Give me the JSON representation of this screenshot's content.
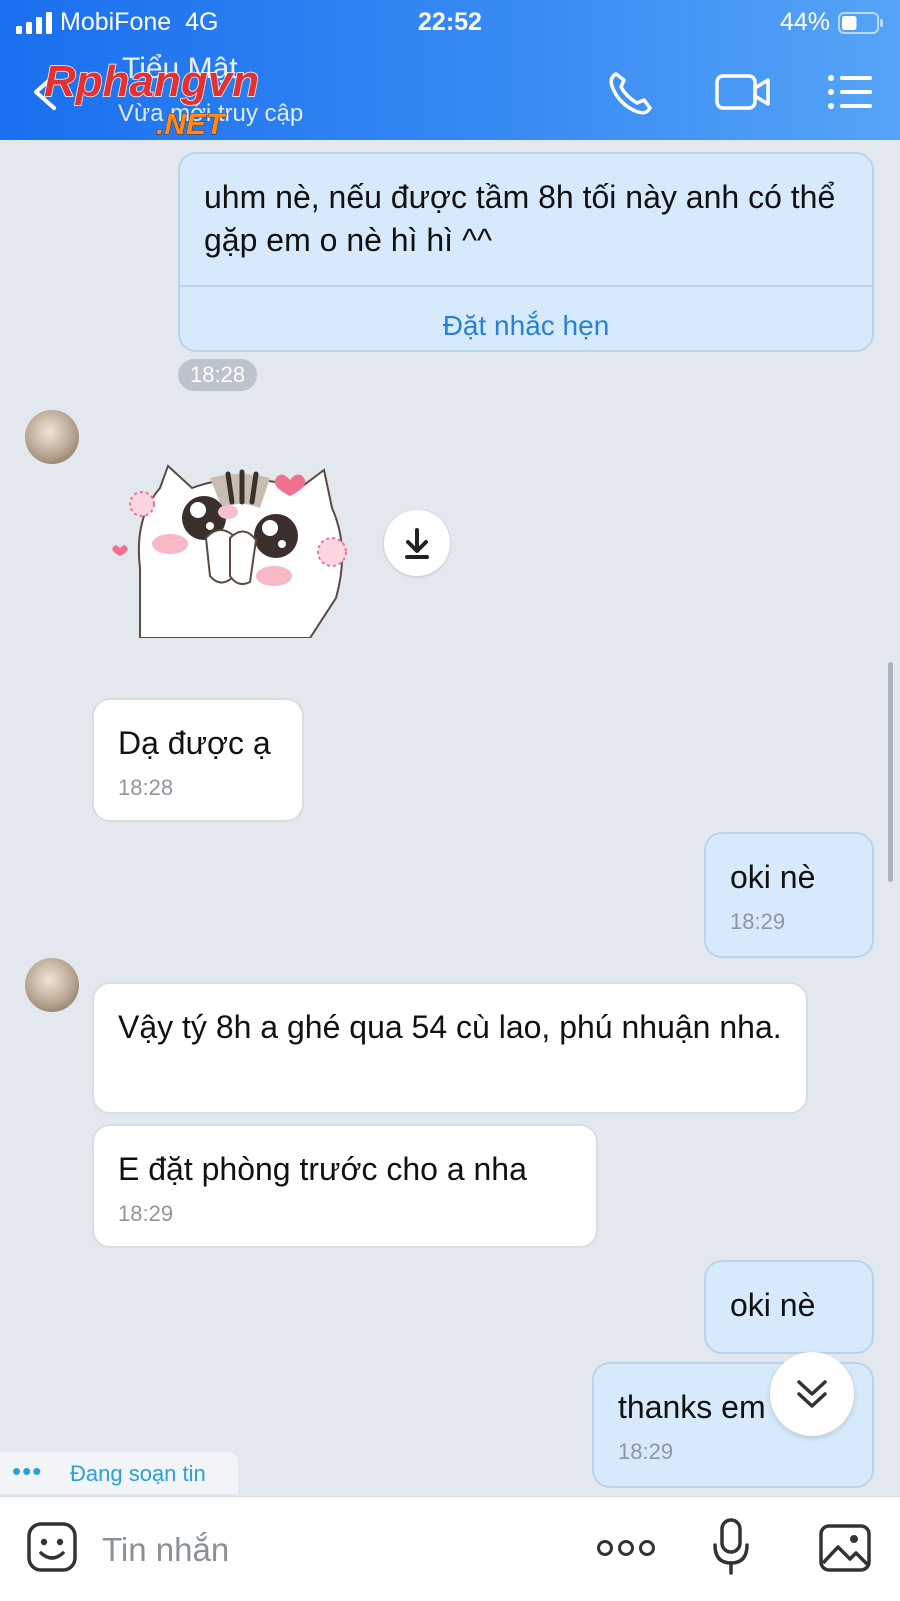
{
  "status_bar": {
    "carrier": "MobiFone",
    "network": "4G",
    "time": "22:52",
    "battery": "44%",
    "battery_level": 0.44
  },
  "header": {
    "contact_name": "Tiểu Mật",
    "contact_status": "Vừa mới truy cập",
    "watermark_brand": "Rphangvn",
    "watermark_domain": ".NET"
  },
  "messages": [
    {
      "side": "sent",
      "text": "uhm nè, nếu được tầm 8h tối này anh có thể gặp em o nè hì hì ^^",
      "action": "Đặt nhắc hẹn",
      "time": "18:28"
    },
    {
      "side": "received",
      "type": "sticker",
      "sticker": "cat-sticker"
    },
    {
      "side": "received",
      "text": "Dạ được ạ",
      "time": "18:28"
    },
    {
      "side": "sent",
      "text": "oki nè",
      "time": "18:29"
    },
    {
      "side": "received",
      "text": "Vậy tý 8h a ghé qua 54 cù lao, phú nhuận nha.",
      "time": ""
    },
    {
      "side": "received",
      "text": "E đặt phòng trước cho a nha",
      "time": "18:29"
    },
    {
      "side": "sent",
      "text": "oki nè",
      "time": ""
    },
    {
      "side": "sent",
      "text": "thanks em",
      "time": "18:29"
    }
  ],
  "typing_indicator": {
    "dots": "•••",
    "label": "Đang soạn tin"
  },
  "input_bar": {
    "placeholder": "Tin nhắn"
  },
  "colors": {
    "header_blue": "#1a6fef",
    "sent_bubble": "#d6eafb",
    "received_bubble": "#ffffff",
    "link_blue": "#2a80d5"
  }
}
